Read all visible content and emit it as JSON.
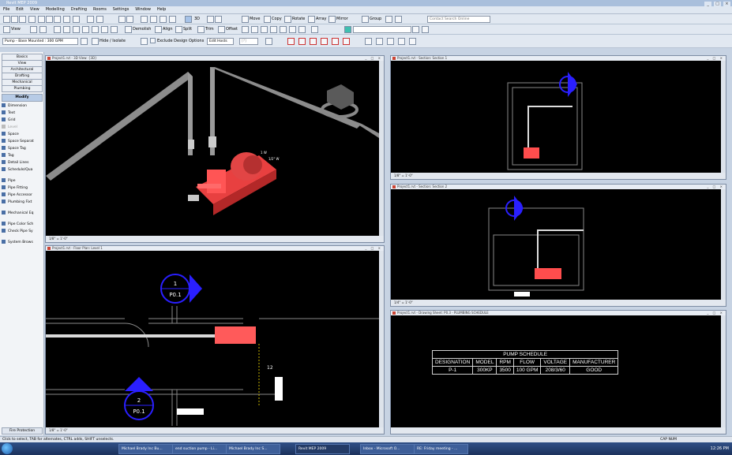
{
  "app": {
    "title": "Revit MEP 2009"
  },
  "window_buttons": [
    "_",
    "□",
    "×"
  ],
  "menu": [
    "File",
    "Edit",
    "View",
    "Modelling",
    "Drafting",
    "Rooms",
    "Settings",
    "Window",
    "Help"
  ],
  "toolbar1": {
    "view_label": "3D",
    "move": "Move",
    "copy": "Copy",
    "rotate": "Rotate",
    "array": "Array",
    "mirror": "Mirror",
    "group": "Group",
    "search_placeholder": "Contact Search Online"
  },
  "toolbar2": {
    "view": "View",
    "demolish": "Demolish",
    "align": "Align",
    "split": "Split",
    "trim": "Trim",
    "offset": "Offset"
  },
  "toolbar3": {
    "type_select": "Pump - Base Mounted : 300 GPM",
    "hide_isolate": "Hide / Isolate",
    "prompt": "Prompt to Swap",
    "exclude": "Exclude Design Options",
    "edit_hosts": "Edit Hosts",
    "bracket": "[?]"
  },
  "design_bar": {
    "tabs": [
      "Basics",
      "View",
      "Architectural",
      "Drafting",
      "Mechanical",
      "Plumbing"
    ],
    "active_tab": "Modify",
    "tools": [
      {
        "label": "Dimension",
        "enabled": true
      },
      {
        "label": "Text",
        "enabled": true
      },
      {
        "label": "Grid",
        "enabled": true
      },
      {
        "label": "Level",
        "enabled": false
      },
      {
        "label": "Space",
        "enabled": true
      },
      {
        "label": "Space Separat",
        "enabled": true
      },
      {
        "label": "Space Tag",
        "enabled": true
      },
      {
        "label": "Tag",
        "enabled": true
      },
      {
        "label": "Detail Lines",
        "enabled": true
      },
      {
        "label": "Schedule/Qua",
        "enabled": true
      },
      {
        "label": "Pipe",
        "enabled": true
      },
      {
        "label": "Pipe Fitting",
        "enabled": true
      },
      {
        "label": "Pipe Accessor",
        "enabled": true
      },
      {
        "label": "Plumbing Fixt",
        "enabled": true
      },
      {
        "label": "Mechanical Eq",
        "enabled": true
      },
      {
        "label": "Pipe Color Sch",
        "enabled": true
      },
      {
        "label": "Check Pipe Sy",
        "enabled": true
      },
      {
        "label": "System Brows",
        "enabled": true
      }
    ],
    "bottom": "Fire Protection"
  },
  "views": {
    "v3d": {
      "title": "Project1.rvt - 3D View: {3D}",
      "scale": "1/8\" = 1'-0\"",
      "tag1": "1 W",
      "tag2": "1/2\" W"
    },
    "section1": {
      "title": "Project1.rvt - Section: Section 1",
      "scale": "1/8\" = 1'-0\""
    },
    "section2": {
      "title": "Project1.rvt - Section: Section 2",
      "scale": "1/4\" = 1'-0\""
    },
    "plan": {
      "title": "Project1.rvt - Floor Plan: Level 1",
      "scale": "1/8\" = 1'-0\"",
      "tag_top_num": "1",
      "tag_top_sheet": "P0.1",
      "tag_bot_num": "2",
      "tag_bot_sheet": "P0.1",
      "dim": "12"
    },
    "sheet": {
      "title": "Project1.rvt - Drawing Sheet: P0.3 - PLUMBING SCHEDULE",
      "scale": ""
    }
  },
  "schedule": {
    "title": "PUMP SCHEDULE",
    "headers": [
      "DESIGNATION",
      "MODEL",
      "RPM",
      "FLOW",
      "VOLTAGE",
      "MANUFACTURER"
    ],
    "rows": [
      [
        "P-1",
        "300KP",
        "3500",
        "100 GPM",
        "208/3/60",
        "GOOD"
      ]
    ]
  },
  "status": {
    "message": "Click to select, TAB for alternates, CTRL adds, SHIFT unselects.",
    "caps": "CAP  NUM"
  },
  "taskbar": {
    "items": [
      {
        "label": "Michael Brady Inc Bu...",
        "active": false
      },
      {
        "label": "end suction pump - Li...",
        "active": false
      },
      {
        "label": "Michael Brady Inc S...",
        "active": false
      },
      {
        "label": "Revit MEP 2009",
        "active": true
      },
      {
        "label": "Inbox - Microsoft O...",
        "active": false
      },
      {
        "label": "RE: Friday meeting - ...",
        "active": false
      }
    ],
    "clock": "12:26 PM"
  },
  "colors": {
    "pump": "#ff4d4d",
    "tag": "#2a1fff",
    "pipe": "#a0a0a0",
    "canvas": "#000000"
  }
}
